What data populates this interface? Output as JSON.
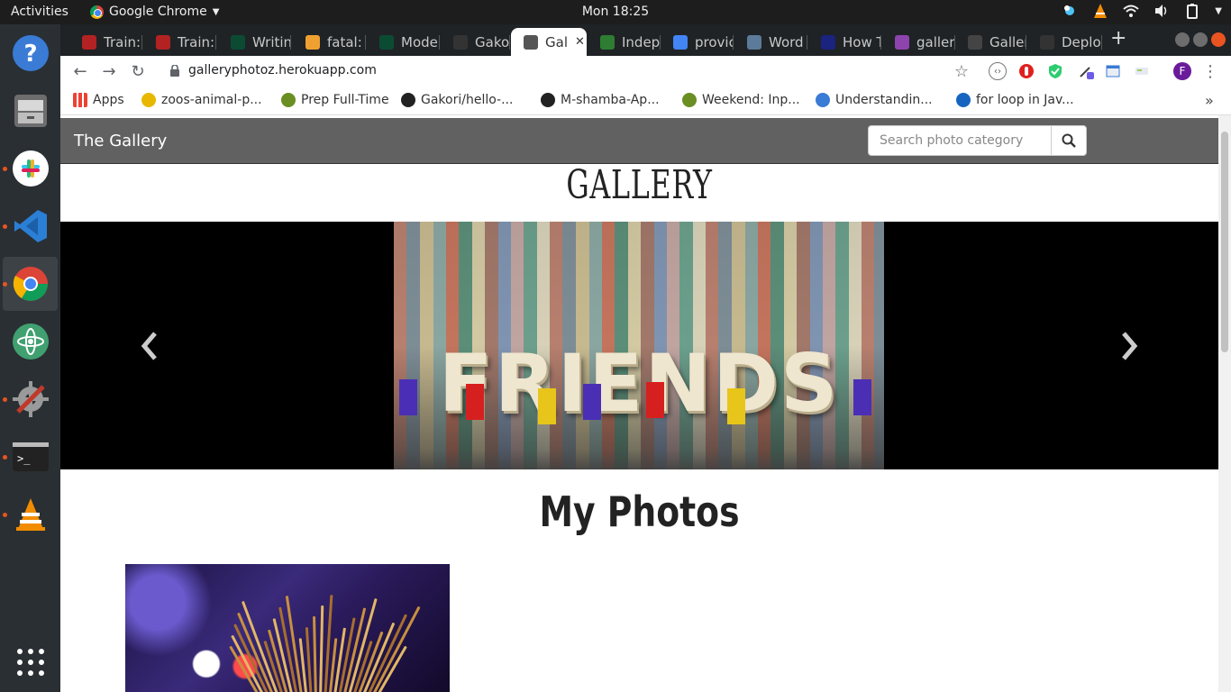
{
  "system": {
    "activities": "Activities",
    "app_name": "Google Chrome",
    "clock": "Mon 18:25"
  },
  "dock": {
    "apps": [
      {
        "name": "Help",
        "color": "#3a7bd5"
      },
      {
        "name": "Files",
        "color": "#7c7c7c"
      },
      {
        "name": "Slack",
        "color": "#ffffff"
      },
      {
        "name": "Visual Studio Code",
        "color": "#2b7fd5"
      },
      {
        "name": "Google Chrome",
        "color": "#4285f4"
      },
      {
        "name": "Atom",
        "color": "#40a070"
      },
      {
        "name": "Preferences",
        "color": "#c0392b"
      },
      {
        "name": "Terminal",
        "color": "#222222"
      },
      {
        "name": "VLC",
        "color": "#f28c00"
      }
    ]
  },
  "browser": {
    "tabs": [
      {
        "label": "Train:",
        "fav": "#b22222"
      },
      {
        "label": "Train:",
        "fav": "#b22222"
      },
      {
        "label": "Writin",
        "fav": "#0c4b33"
      },
      {
        "label": "fatal:",
        "fav": "#f0a030"
      },
      {
        "label": "Mode",
        "fav": "#0c4b33"
      },
      {
        "label": "Gakor",
        "fav": "#333333"
      },
      {
        "label": "Gal",
        "fav": "#555555"
      },
      {
        "label": "Indep",
        "fav": "#2e7d32"
      },
      {
        "label": "provic",
        "fav": "#4285f4"
      },
      {
        "label": "Word",
        "fav": "#5c7a99"
      },
      {
        "label": "How T",
        "fav": "#1a237e"
      },
      {
        "label": "galler",
        "fav": "#8e44ad"
      },
      {
        "label": "Galler",
        "fav": "#444444"
      },
      {
        "label": "Deplo",
        "fav": "#333333"
      }
    ],
    "new_tab": "+",
    "url": "galleryphotoz.herokuapp.com",
    "profile_initial": "F",
    "bookmarks": [
      {
        "label": "Apps",
        "fav": "#ea4335"
      },
      {
        "label": "zoos-animal-p...",
        "fav": "#e8b800"
      },
      {
        "label": "Prep Full-Time",
        "fav": "#6b8e23"
      },
      {
        "label": "Gakori/hello-...",
        "fav": "#222222"
      },
      {
        "label": "M-shamba-Ap...",
        "fav": "#222222"
      },
      {
        "label": "Weekend: Inp...",
        "fav": "#6b8e23"
      },
      {
        "label": "Understandin...",
        "fav": "#3a7bd5"
      },
      {
        "label": "for loop in Jav...",
        "fav": "#1565c0"
      }
    ],
    "more": "»"
  },
  "site": {
    "brand": "The Gallery",
    "search_placeholder": "Search photo category",
    "heading": "GALLERY",
    "carousel": {
      "word": "FRIENDS",
      "slide_count": 3,
      "active_index": 1
    },
    "photos_heading": "My Photos"
  }
}
